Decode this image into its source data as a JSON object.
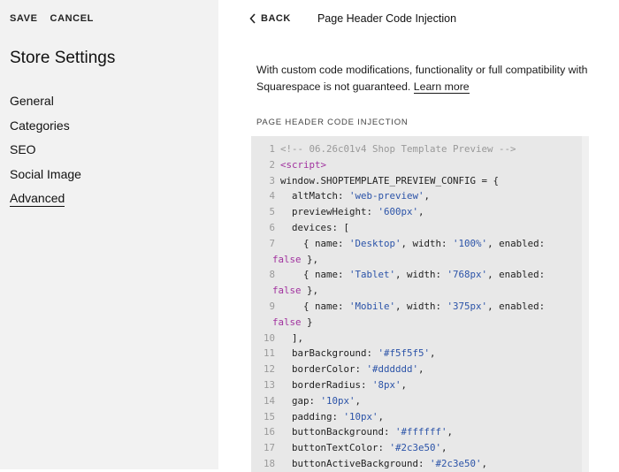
{
  "left_panel": {
    "save_label": "SAVE",
    "cancel_label": "CANCEL",
    "title": "Store Settings",
    "nav": [
      "General",
      "Categories",
      "SEO",
      "Social Image",
      "Advanced"
    ],
    "active_nav": "Advanced"
  },
  "right_panel": {
    "back_label": "BACK",
    "title": "Page Header Code Injection",
    "warning_text": "With custom code modifications, functionality or full compatibility with Squarespace is not guaranteed.",
    "learn_more": "Learn more",
    "section_label": "PAGE HEADER CODE INJECTION",
    "code_lines": [
      "<!-- 06.26c01v4 Shop Template Preview -->",
      "<script>",
      "window.SHOPTEMPLATE_PREVIEW_CONFIG = {",
      "  altMatch: 'web-preview',",
      "  previewHeight: '600px',",
      "  devices: [",
      "    { name: 'Desktop', width: '100%', enabled: false },",
      "    { name: 'Tablet', width: '768px', enabled: false },",
      "    { name: 'Mobile', width: '375px', enabled: false }",
      "  ],",
      "  barBackground: '#f5f5f5',",
      "  borderColor: '#dddddd',",
      "  borderRadius: '8px',",
      "  gap: '10px',",
      "  padding: '10px',",
      "  buttonBackground: '#ffffff',",
      "  buttonTextColor: '#2c3e50',",
      "  buttonActiveBackground: '#2c3e50',"
    ]
  },
  "colors": {
    "sidebar_bg": "#f2f2f2",
    "editor_bg": "#e8e8e8",
    "syntax_string": "#2b53a8",
    "syntax_tag": "#a1329f",
    "syntax_comment": "#999999"
  }
}
